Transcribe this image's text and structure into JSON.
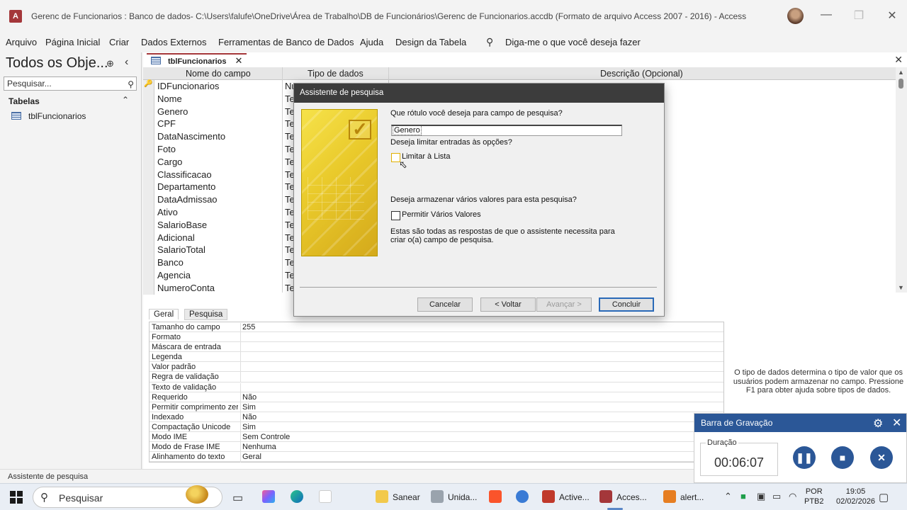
{
  "window": {
    "title": "Gerenc de Funcionarios : Banco de dados- C:\\Users\\falufe\\OneDrive\\Área de Trabalho\\DB de Funcionários\\Gerenc de Funcionarios.accdb (Formato de arquivo Access 2007 - 2016)  -  Access",
    "app_icon": "A",
    "minimize": "—",
    "restore": "❐",
    "close": "✕"
  },
  "ribbon": {
    "tabs": [
      "Arquivo",
      "Página Inicial",
      "Criar",
      "Dados Externos",
      "Ferramentas de Banco de Dados",
      "Ajuda",
      "Design da Tabela"
    ],
    "tell_me": "Diga-me o que você deseja fazer",
    "accent_color": "#a4373a"
  },
  "nav_pane": {
    "title": "Todos os Obje...",
    "search_placeholder": "Pesquisar...",
    "group": "Tabelas",
    "items": [
      "tblFuncionarios"
    ]
  },
  "document": {
    "tab_label": "tblFuncionarios",
    "columns": [
      "Nome do campo",
      "Tipo de dados",
      "Descrição (Opcional)"
    ],
    "rows": [
      {
        "name": "IDFuncionarios",
        "type": "Nu",
        "key": "🔑"
      },
      {
        "name": "Nome",
        "type": "Te"
      },
      {
        "name": "Genero",
        "type": "Te"
      },
      {
        "name": "CPF",
        "type": "Te"
      },
      {
        "name": "DataNascimento",
        "type": "Te"
      },
      {
        "name": "Foto",
        "type": "Te"
      },
      {
        "name": "Cargo",
        "type": "Te"
      },
      {
        "name": "Classificacao",
        "type": "Te"
      },
      {
        "name": "Departamento",
        "type": "Te"
      },
      {
        "name": "DataAdmissao",
        "type": "Te"
      },
      {
        "name": "Ativo",
        "type": "Te"
      },
      {
        "name": "SalarioBase",
        "type": "Te"
      },
      {
        "name": "Adicional",
        "type": "Te"
      },
      {
        "name": "SalarioTotal",
        "type": "Te"
      },
      {
        "name": "Banco",
        "type": "Te"
      },
      {
        "name": "Agencia",
        "type": "Te"
      },
      {
        "name": "NumeroConta",
        "type": "Te"
      }
    ],
    "prop_tabs": [
      "Geral",
      "Pesquisa"
    ],
    "properties": [
      {
        "label": "Tamanho do campo",
        "value": "255"
      },
      {
        "label": "Formato",
        "value": ""
      },
      {
        "label": "Máscara de entrada",
        "value": ""
      },
      {
        "label": "Legenda",
        "value": ""
      },
      {
        "label": "Valor padrão",
        "value": ""
      },
      {
        "label": "Regra de validação",
        "value": ""
      },
      {
        "label": "Texto de validação",
        "value": ""
      },
      {
        "label": "Requerido",
        "value": "Não"
      },
      {
        "label": "Permitir comprimento zer",
        "value": "Sim"
      },
      {
        "label": "Indexado",
        "value": "Não"
      },
      {
        "label": "Compactação Unicode",
        "value": "Sim"
      },
      {
        "label": "Modo IME",
        "value": "Sem Controle"
      },
      {
        "label": "Modo de Frase IME",
        "value": "Nenhuma"
      },
      {
        "label": "Alinhamento do texto",
        "value": "Geral"
      }
    ],
    "help_text": "O tipo de dados determina o tipo de valor que os usuários podem armazenar no campo. Pressione F1 para obter ajuda sobre tipos de dados."
  },
  "dialog": {
    "title": "Assistente de pesquisa",
    "q_label": "Que rótulo você deseja para campo de pesquisa?",
    "label_value": "Genero",
    "q_limit": "Deseja limitar entradas às opções?",
    "limit_option": "Limitar à Lista",
    "q_multi": "Deseja armazenar vários valores para esta pesquisa?",
    "multi_option": "Permitir Vários Valores",
    "info_line1": "Estas são todas as respostas de que o assistente necessita para",
    "info_line2": "criar o(a) campo de pesquisa.",
    "buttons": {
      "cancel": "Cancelar",
      "back": "< Voltar",
      "next": "Avançar >",
      "finish": "Concluir"
    }
  },
  "status_bar": {
    "text": "Assistente de pesquisa"
  },
  "recording_bar": {
    "title": "Barra de Gravação",
    "duration_label": "Duração",
    "duration": "00:06:07"
  },
  "taskbar": {
    "search": "Pesquisar",
    "apps": [
      "Sanear",
      "Unida...",
      "Active...",
      "Acces...",
      "alert..."
    ],
    "lang1": "POR",
    "lang2": "PTB2",
    "time": "19:05",
    "date": "02/02/2026"
  }
}
